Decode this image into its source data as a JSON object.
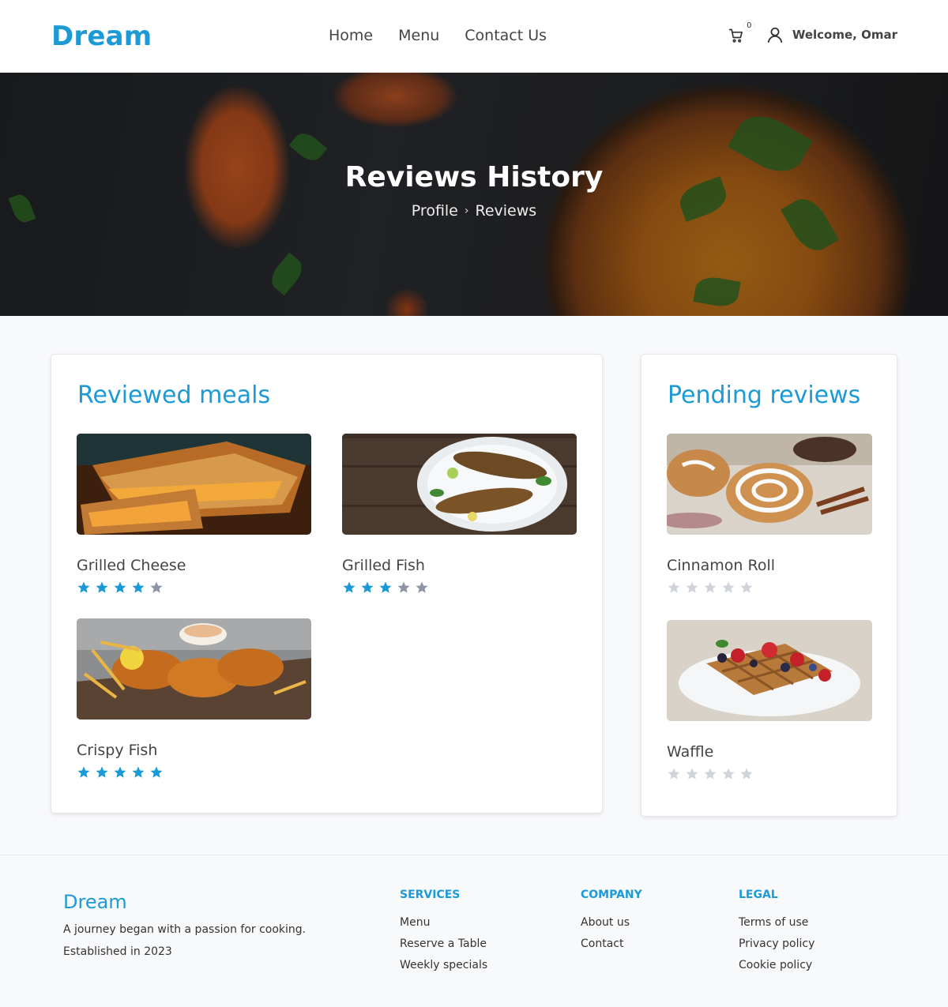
{
  "brand": "Dream",
  "nav": [
    "Home",
    "Menu",
    "Contact Us"
  ],
  "cart_count": "0",
  "welcome": "Welcome, Omar",
  "hero": {
    "title": "Reviews History",
    "breadcrumb": [
      "Profile",
      "Reviews"
    ]
  },
  "reviewed": {
    "title": "Reviewed meals",
    "meals": [
      {
        "name": "Grilled Cheese",
        "rating": 4
      },
      {
        "name": "Grilled Fish",
        "rating": 3
      },
      {
        "name": "Crispy Fish",
        "rating": 5
      }
    ]
  },
  "pending": {
    "title": "Pending reviews",
    "meals": [
      {
        "name": "Cinnamon Roll",
        "rating": 0
      },
      {
        "name": "Waffle",
        "rating": 0
      }
    ]
  },
  "colors": {
    "accent": "#1c9ad6",
    "star_filled": "#1c9ad6",
    "star_empty_reviewed": "#8c95a3",
    "star_empty_pending": "#cfd4db"
  },
  "footer": {
    "brand": "Dream",
    "tagline": "A journey began with a passion for cooking.",
    "established": "Established in 2023",
    "columns": [
      {
        "heading": "SERVICES",
        "links": [
          "Menu",
          "Reserve a Table",
          "Weekly specials"
        ]
      },
      {
        "heading": "COMPANY",
        "links": [
          "About us",
          "Contact"
        ]
      },
      {
        "heading": "LEGAL",
        "links": [
          "Terms of use",
          "Privacy policy",
          "Cookie policy"
        ]
      }
    ]
  }
}
